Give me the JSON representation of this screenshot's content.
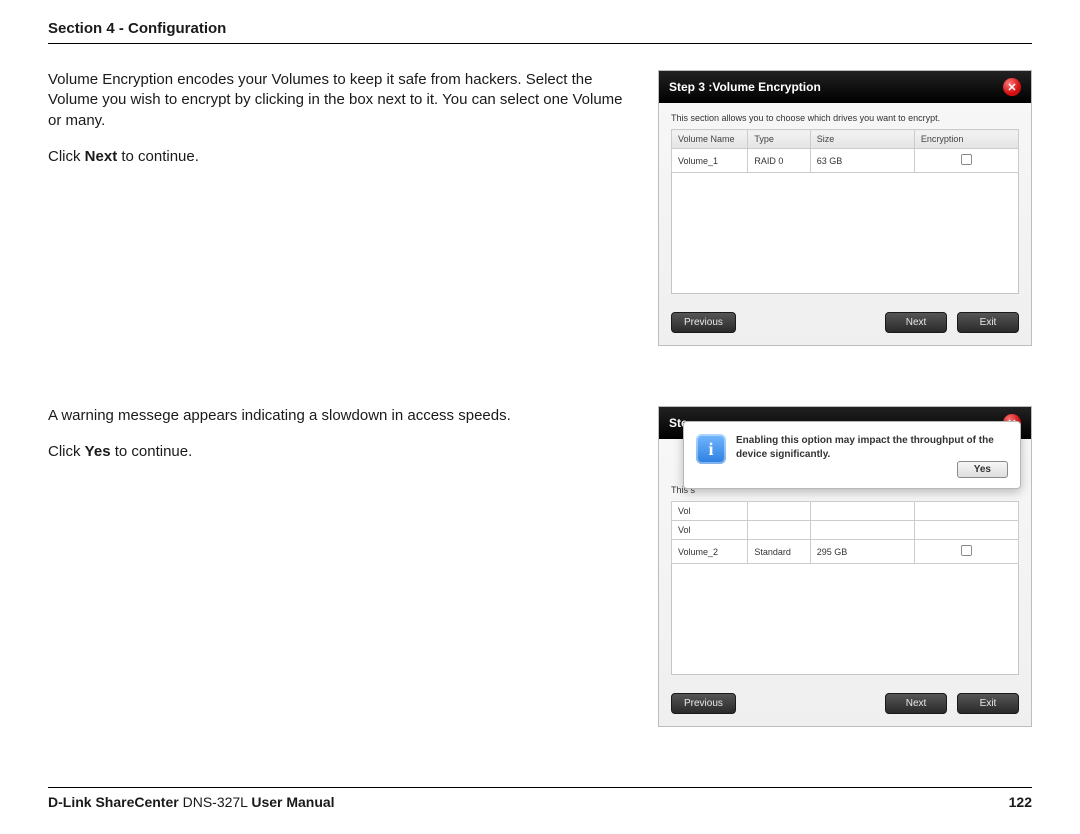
{
  "header": {
    "title": "Section 4 - Configuration"
  },
  "block1": {
    "para1": "Volume Encryption encodes your Volumes to keep it safe from hackers. Select the Volume you wish to encrypt by clicking in the box next to it. You can select one Volume or many.",
    "para2_a": "Click ",
    "para2_b": "Next",
    "para2_c": " to continue."
  },
  "block2": {
    "para1": "A warning messege appears indicating a slowdown in access speeds.",
    "para2_a": "Click ",
    "para2_b": "Yes",
    "para2_c": " to continue."
  },
  "panel1": {
    "title": "Step 3 :Volume Encryption",
    "desc": "This section allows you to choose which drives you want to encrypt.",
    "cols": {
      "c1": "Volume Name",
      "c2": "Type",
      "c3": "Size",
      "c4": "Encryption"
    },
    "row": {
      "name": "Volume_1",
      "type": "RAID 0",
      "size": "63 GB"
    },
    "buttons": {
      "prev": "Previous",
      "next": "Next",
      "exit": "Exit"
    }
  },
  "panel2": {
    "title_partial": "Ste",
    "desc_partial": "This s",
    "row0_partial": "Vol",
    "row1_partial": "Vol",
    "row2": {
      "name": "Volume_2",
      "type": "Standard",
      "size": "295 GB"
    },
    "modal": {
      "text": "Enabling this option may impact the throughput of the device significantly.",
      "yes": "Yes"
    },
    "buttons": {
      "prev": "Previous",
      "next": "Next",
      "exit": "Exit"
    }
  },
  "footer": {
    "left_bold": "D-Link ShareCenter",
    "left_rest": " DNS-327L ",
    "left_tail_bold": "User Manual",
    "page": "122"
  }
}
